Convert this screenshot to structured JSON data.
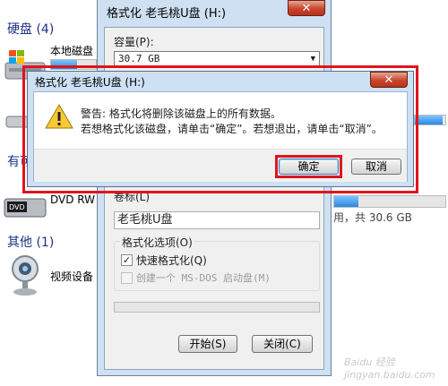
{
  "explorer": {
    "section_hard_disk": "硬盘 (4)",
    "local_disk_label": "本地磁盘",
    "section_removable_partial": "有可",
    "dvd_label": "DVD RW",
    "removable_free_text": "用，共 30.6 GB",
    "section_other": "其他 (1)",
    "video_device_label": "视频设备",
    "bar_fill_levels": [
      0.58,
      0.92,
      0.22
    ]
  },
  "format_dialog": {
    "title": "格式化 老毛桃U盘 (H:)",
    "close_symbol": "✕",
    "capacity_label": "容量(P):",
    "capacity_value": "30.7 GB",
    "volume_label_partial": "卷标(L)",
    "volume_value": "老毛桃U盘",
    "options_group_label": "格式化选项(O)",
    "quick_format_label": "快速格式化(Q)",
    "quick_format_checked": true,
    "msdos_label": "创建一个 MS-DOS 启动盘(M)",
    "msdos_checked": false,
    "start_button": "开始(S)",
    "close_button": "关闭(C)"
  },
  "warning_dialog": {
    "title": "格式化 老毛桃U盘 (H:)",
    "close_symbol": "✕",
    "line1": "警告: 格式化将删除该磁盘上的所有数据。",
    "line2": "若想格式化该磁盘，请单击“确定”。若想退出，请单击“取消”。",
    "ok_button": "确定",
    "cancel_button": "取消"
  },
  "watermark": "Baidu 经验  jingyan.baidu.com"
}
